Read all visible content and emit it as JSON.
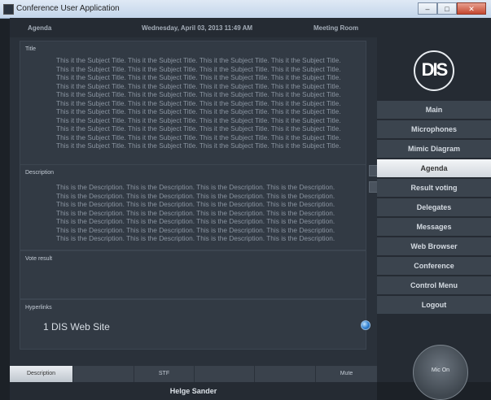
{
  "window": {
    "title": "Conference User Application",
    "buttons": [
      "–",
      "□",
      "✕"
    ]
  },
  "header": {
    "section": "Agenda",
    "datetime": "Wednesday, April 03, 2013 11:49 AM",
    "room": "Meeting Room"
  },
  "title_panel": {
    "label": "Title",
    "text": "This it the Subject Title. This it the Subject Title. This it the Subject Title. This it the Subject Title.\nThis it the Subject Title. This it the Subject Title. This it the Subject Title. This it the Subject Title.\nThis it the Subject Title. This it the Subject Title. This it the Subject Title. This it the Subject Title.\nThis it the Subject Title. This it the Subject Title. This it the Subject Title. This it the Subject Title.\nThis it the Subject Title. This it the Subject Title. This it the Subject Title. This it the Subject Title.\nThis it the Subject Title. This it the Subject Title. This it the Subject Title. This it the Subject Title.\nThis it the Subject Title. This it the Subject Title. This it the Subject Title. This it the Subject Title.\nThis it the Subject Title. This it the Subject Title. This it the Subject Title. This it the Subject Title.\nThis it the Subject Title. This it the Subject Title. This it the Subject Title. This it the Subject Title.\nThis it the Subject Title. This it the Subject Title. This it the Subject Title. This it the Subject Title.\nThis it the Subject Title. This it the Subject Title. This it the Subject Title. This it the Subject Title."
  },
  "description_panel": {
    "label": "Description",
    "text": "This is the Description. This is the Description. This is the Description. This is the Description.\nThis is the Description. This is the Description. This is the Description. This is the Description.\nThis is the Description. This is the Description. This is the Description. This is the Description.\nThis is the Description. This is the Description. This is the Description. This is the Description.\nThis is the Description. This is the Description. This is the Description. This is the Description.\nThis is the Description. This is the Description. This is the Description. This is the Description.\nThis is the Description. This is the Description. This is the Description. This is the Description."
  },
  "vote_panel": {
    "label": "Vote result"
  },
  "links_panel": {
    "label": "Hyperlinks",
    "items": [
      {
        "text": "1  DIS Web Site",
        "icon": "globe-icon"
      }
    ]
  },
  "bottom_bar": {
    "buttons": [
      "Description",
      "STF",
      "",
      "",
      "",
      "Mute"
    ]
  },
  "delegate": {
    "name": "Helge Sander"
  },
  "logo": {
    "text": "DIS"
  },
  "menu": {
    "items": [
      "Main",
      "Microphones",
      "Mimic Diagram",
      "Agenda",
      "Result voting",
      "Delegates",
      "Messages",
      "Web Browser",
      "Conference",
      "Control Menu",
      "Logout"
    ],
    "active": "Agenda"
  },
  "mic_button": {
    "label": "Mic On"
  }
}
